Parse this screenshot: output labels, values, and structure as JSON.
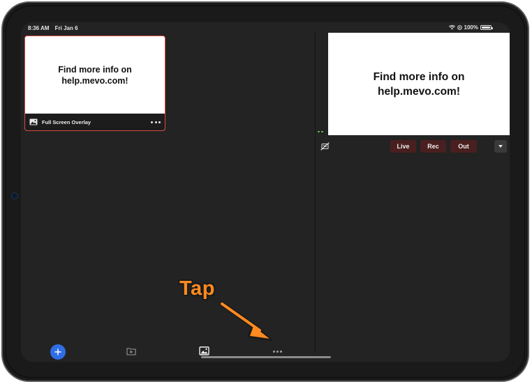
{
  "status_bar": {
    "time": "8:36 AM",
    "date": "Fri Jan 6",
    "battery": "100%"
  },
  "overlay_card": {
    "preview_text": "Find more info on help.mevo.com!",
    "label": "Full Screen Overlay"
  },
  "program_preview": {
    "text": "Find more info on help.mevo.com!"
  },
  "controls": {
    "live_label": "Live",
    "rec_label": "Rec",
    "out_label": "Out"
  },
  "annotation": {
    "text": "Tap"
  },
  "icons": [
    "wifi-icon",
    "location-icon",
    "battery-icon",
    "image-icon",
    "more-icon",
    "plus-icon",
    "media-play-icon",
    "overlay-image-icon",
    "hide-icon",
    "chevron-down-icon",
    "arrow-icon"
  ],
  "colors": {
    "accent_blue": "#2f6ee6",
    "selection_red": "#d94b3f",
    "annotation_orange": "#ff8a1f",
    "pill_bg": "#4a1f1f"
  }
}
